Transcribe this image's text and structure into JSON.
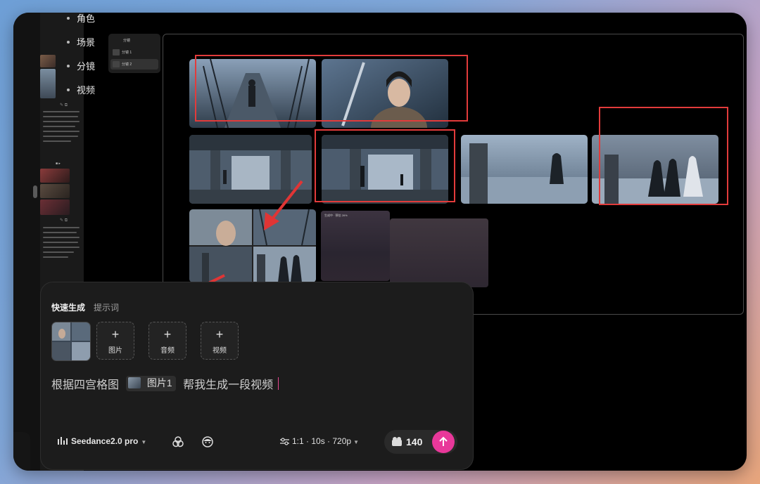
{
  "steps": [
    {
      "label": "角色"
    },
    {
      "label": "场景"
    },
    {
      "label": "分镜"
    },
    {
      "label": "视频"
    }
  ],
  "mini_list": [
    {
      "label": "分镜"
    },
    {
      "label": "分镜 1"
    },
    {
      "label": "分镜 2"
    }
  ],
  "gen_status_label": "生成中 · 预估 26%",
  "prompt_panel": {
    "tabs": [
      {
        "label": "快速生成",
        "active": true
      },
      {
        "label": "提示词",
        "active": false
      }
    ],
    "add_buttons": [
      {
        "label": "图片",
        "icon": "plus-icon"
      },
      {
        "label": "音频",
        "icon": "plus-icon"
      },
      {
        "label": "视频",
        "icon": "plus-icon"
      }
    ],
    "prompt_before": "根据四宫格图",
    "chip_label": "图片1",
    "prompt_after": "帮我生成一段视频",
    "model_label": "Seedance2.0 pro",
    "settings_label": "1:1 · 10s · 720p",
    "credits": "140"
  },
  "colors": {
    "accent": "#e8389a",
    "highlight_box": "#e23b3b",
    "annotation_arrow": "#e03535"
  }
}
